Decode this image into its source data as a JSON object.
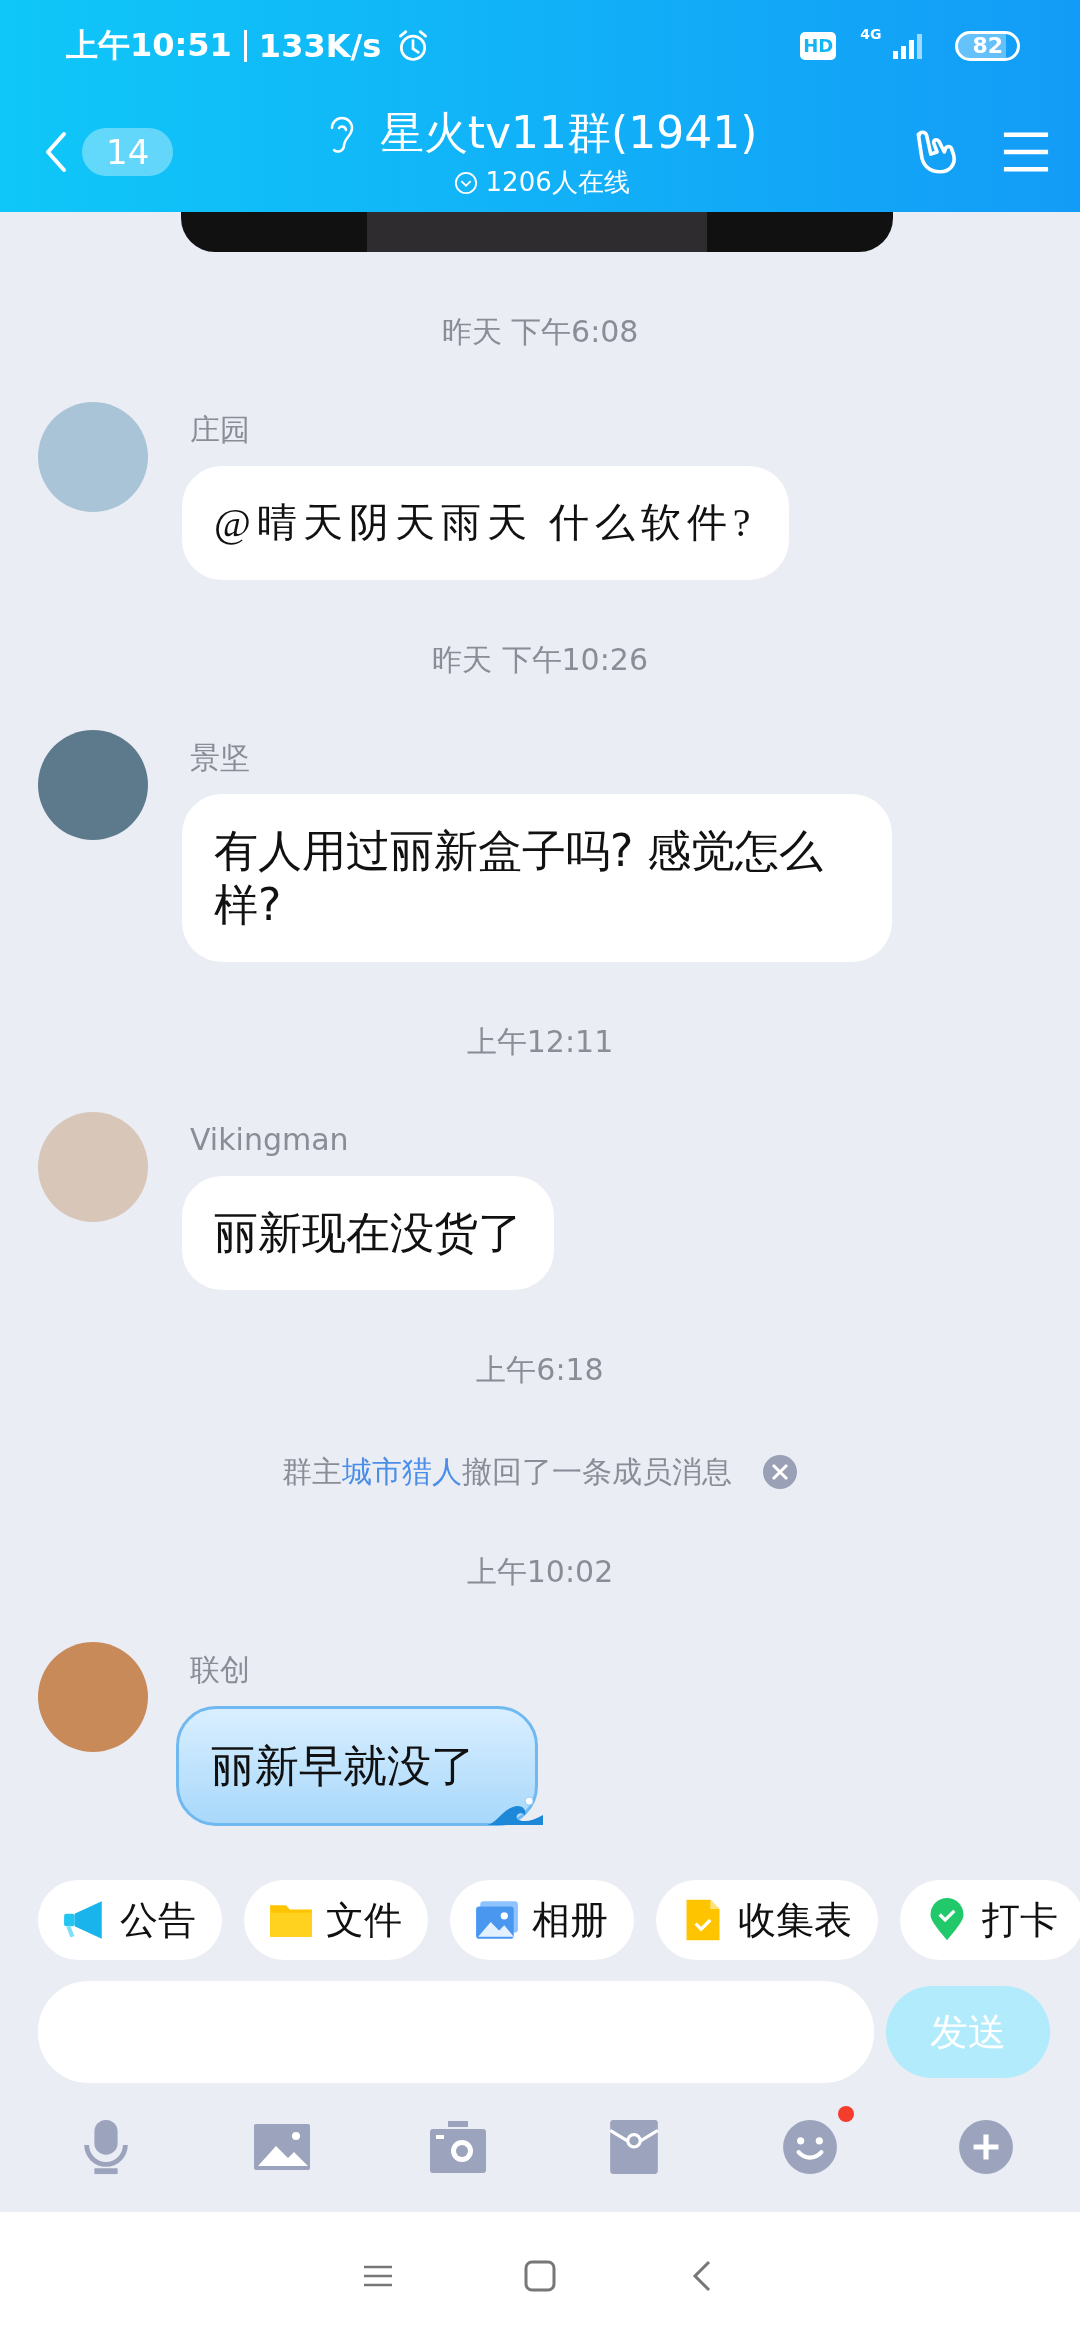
{
  "status_bar": {
    "time": "上午10:51",
    "speed": "133K/s",
    "hd": "HD",
    "network": "4G",
    "battery": "82"
  },
  "header": {
    "unread": "14",
    "title": "星火tv11群(1941)",
    "online": "1206人在线"
  },
  "chat": [
    {
      "kind": "time",
      "text": "昨天 下午6:08"
    },
    {
      "kind": "art_text",
      "name": "庄园",
      "text": "@晴天阴天雨天 什么软件?"
    },
    {
      "kind": "time",
      "text": "昨天 下午10:26"
    },
    {
      "kind": "text",
      "name": "景坚",
      "text": "有人用过丽新盒子吗? 感觉怎么样?"
    },
    {
      "kind": "time",
      "text": "上午12:11"
    },
    {
      "kind": "text",
      "name": "Vikingman",
      "text": "丽新现在没货了"
    },
    {
      "kind": "time",
      "text": "上午6:18"
    },
    {
      "kind": "recall",
      "prefix": "群主",
      "link": "城市猎人",
      "suffix": "撤回了一条成员消息"
    },
    {
      "kind": "time",
      "text": "上午10:02"
    },
    {
      "kind": "themed_text",
      "name": "联创",
      "text": "丽新早就没了"
    }
  ],
  "shortcuts": [
    {
      "kind": "notice",
      "label": "公告"
    },
    {
      "kind": "file",
      "label": "文件"
    },
    {
      "kind": "album",
      "label": "相册"
    },
    {
      "kind": "form",
      "label": "收集表"
    },
    {
      "kind": "checkin",
      "label": "打卡"
    }
  ],
  "composer": {
    "send": "发送",
    "send_disabled": true
  },
  "toolbar": [
    {
      "kind": "mic",
      "badge": false
    },
    {
      "kind": "image",
      "badge": false
    },
    {
      "kind": "camera",
      "badge": false
    },
    {
      "kind": "packet",
      "badge": false
    },
    {
      "kind": "emoji",
      "badge": true
    },
    {
      "kind": "plus",
      "badge": false
    }
  ]
}
